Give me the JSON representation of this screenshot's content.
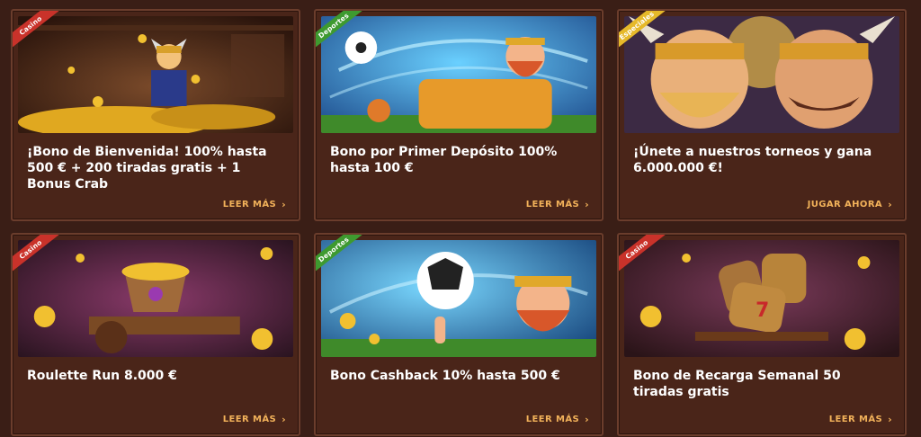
{
  "cards": [
    {
      "tag": "Casino",
      "tag_color": "#c9322a",
      "title": "¡Bono de Bienvenida! 100% hasta 500 € + 200 tiradas gratis + 1 Bonus Crab",
      "cta": "LEER MÁS"
    },
    {
      "tag": "Deportes",
      "tag_color": "#3e9a2f",
      "title": "Bono por Primer Depósito 100% hasta 100 €",
      "cta": "LEER MÁS"
    },
    {
      "tag": "Especiales",
      "tag_color": "#e6b92a",
      "title": "¡Únete a nuestros torneos y gana 6.000.000 €!",
      "cta": "JUGAR AHORA"
    },
    {
      "tag": "Casino",
      "tag_color": "#c9322a",
      "title": "Roulette Run 8.000 €",
      "cta": "LEER MÁS"
    },
    {
      "tag": "Deportes",
      "tag_color": "#3e9a2f",
      "title": "Bono Cashback 10% hasta 500 €",
      "cta": "LEER MÁS"
    },
    {
      "tag": "Casino",
      "tag_color": "#c9322a",
      "title": "Bono de Recarga Semanal 50 tiradas gratis",
      "cta": "LEER MÁS"
    }
  ],
  "icons": {
    "cta_arrow": "chevron-right-icon"
  },
  "colors": {
    "background": "#3a1e16",
    "card": "#4a2519",
    "cta": "#f2b25a"
  }
}
